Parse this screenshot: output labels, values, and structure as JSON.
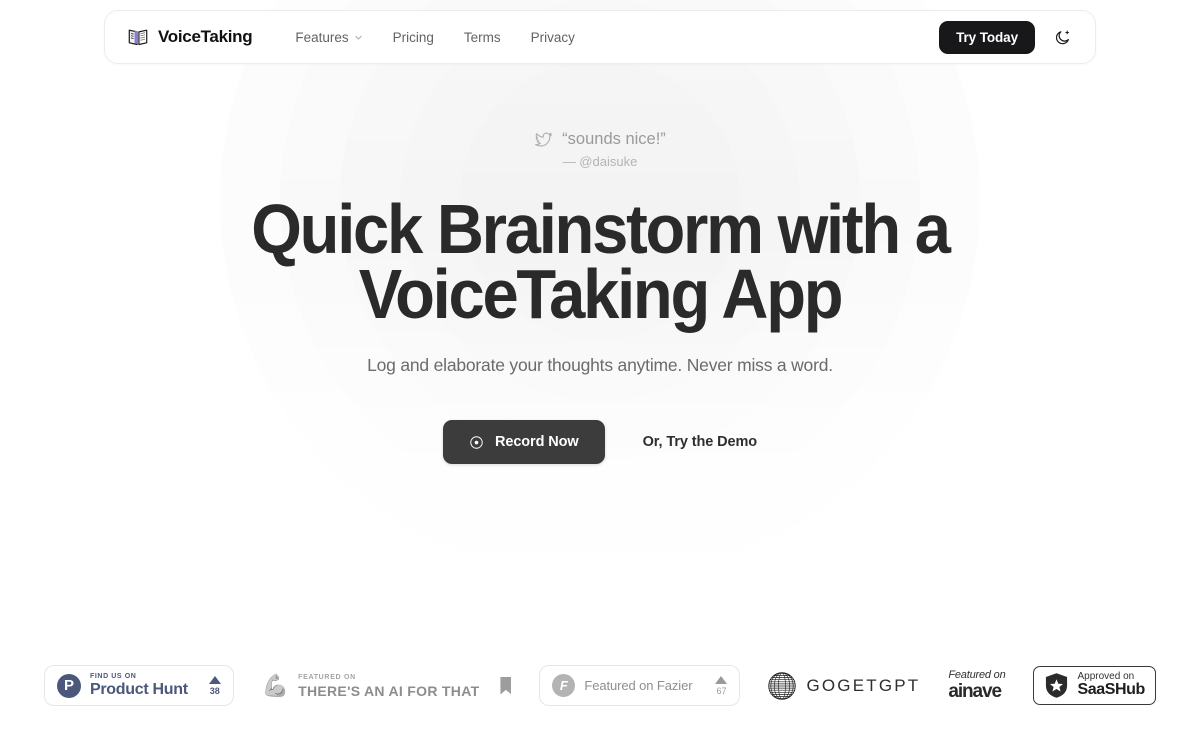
{
  "brand": {
    "name": "VoiceTaking",
    "logo_icon": "open-book-icon"
  },
  "nav": {
    "items": [
      {
        "label": "Features",
        "has_dropdown": true
      },
      {
        "label": "Pricing",
        "has_dropdown": false
      },
      {
        "label": "Terms",
        "has_dropdown": false
      },
      {
        "label": "Privacy",
        "has_dropdown": false
      }
    ],
    "cta_label": "Try Today",
    "theme_toggle_icon": "moon-sparkle-icon"
  },
  "hero": {
    "quote_icon": "twitter-bird-icon",
    "quote_text": "“sounds nice!”",
    "quote_author": "— @daisuke",
    "headline_line1": "Quick Brainstorm with a",
    "headline_line2": "VoiceTaking App",
    "subheadline": "Log and elaborate your thoughts anytime. Never miss a word.",
    "record_label": "Record Now",
    "record_icon": "record-dot-icon",
    "demo_label": "Or, Try the Demo"
  },
  "badges": {
    "product_hunt": {
      "mark": "P",
      "eyebrow": "FIND US ON",
      "title": "Product Hunt",
      "votes": "38"
    },
    "taaft": {
      "logo_icon": "flexed-biceps-icon",
      "eyebrow": "FEATURED ON",
      "title": "THERE'S AN AI FOR THAT",
      "bookmark_icon": "bookmark-icon"
    },
    "fazier": {
      "mark": "F",
      "title": "Featured on Fazier",
      "votes": "67"
    },
    "gogetgpt": {
      "logo_icon": "striped-orb-icon",
      "title": "GOGETGPT"
    },
    "ainave": {
      "eyebrow": "Featured on",
      "title": "ainave"
    },
    "saashub": {
      "logo_icon": "shield-star-icon",
      "eyebrow": "Approved on",
      "title": "SaaSHub"
    }
  },
  "colors": {
    "page_bg": "#ffffff",
    "ink": "#18181b",
    "muted": "#6b6b6b",
    "cta_dark": "#3c3c3c",
    "product_hunt": "#4b587c",
    "logo_accent": "#8b7bd8"
  }
}
